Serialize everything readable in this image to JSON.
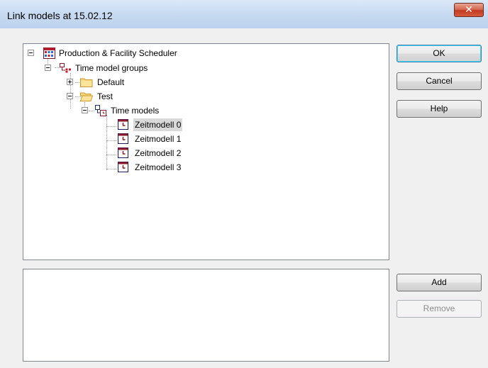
{
  "window": {
    "title": "Link models at 15.02.12",
    "close_glyph": "✕"
  },
  "tree": {
    "root": {
      "label": "Production & Facility Scheduler",
      "icon": "scheduler-icon"
    },
    "groups": {
      "label": "Time model groups",
      "icon": "hierarchy-icon"
    },
    "default_folder": {
      "label": "Default",
      "icon": "folder-icon"
    },
    "test_folder": {
      "label": "Test",
      "icon": "folder-open-icon"
    },
    "time_models": {
      "label": "Time models",
      "icon": "hierarchy-icon"
    },
    "models": [
      "Zeitmodell 0",
      "Zeitmodell 1",
      "Zeitmodell 2",
      "Zeitmodell 3"
    ],
    "selected_model": "Zeitmodell 0"
  },
  "buttons": {
    "ok": "OK",
    "cancel": "Cancel",
    "help": "Help",
    "add": "Add",
    "remove": "Remove"
  },
  "colors": {
    "titlebar": "#c6d9f1",
    "close": "#c23b22",
    "accent": "#3c7fb1",
    "model_icon": "#8b1a2b"
  }
}
